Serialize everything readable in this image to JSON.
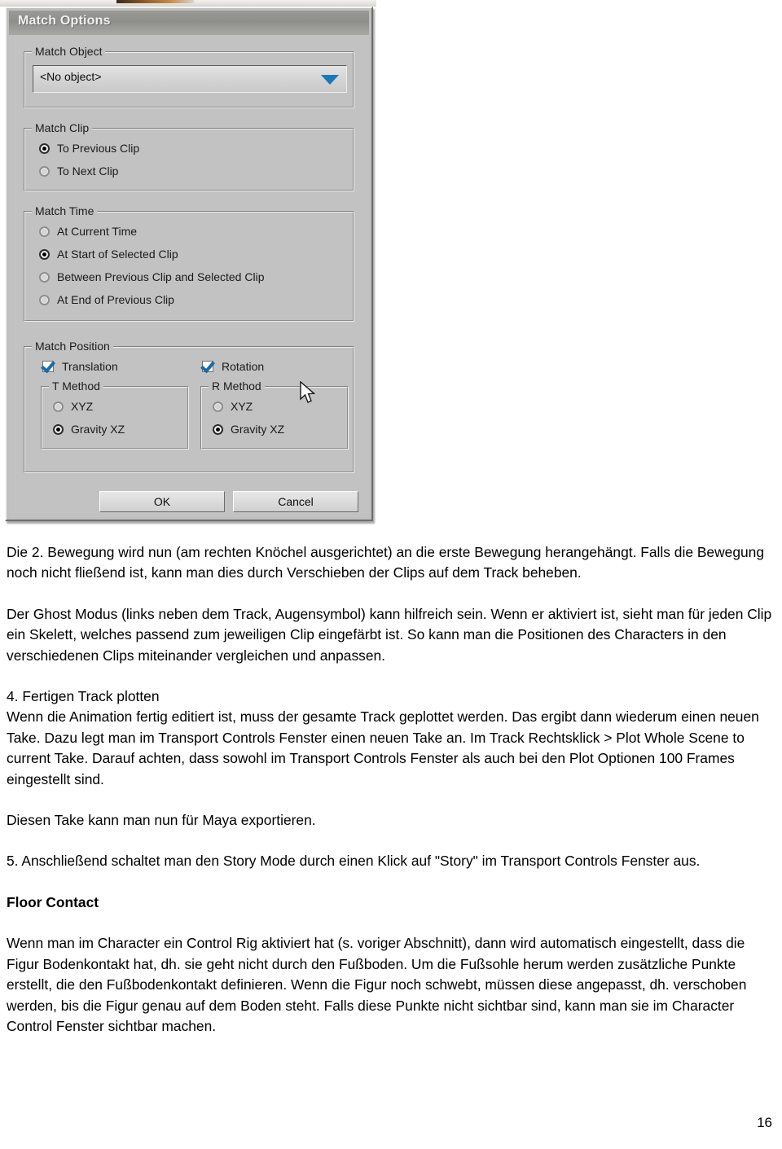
{
  "dialog": {
    "title": "Match Options",
    "match_object": {
      "group_label": "Match Object",
      "dropdown_value": "<No object>",
      "dropdown_icon": "chevron-down-icon"
    },
    "match_clip": {
      "group_label": "Match Clip",
      "options": [
        {
          "label": "To Previous Clip",
          "selected": true
        },
        {
          "label": "To Next Clip",
          "selected": false
        }
      ]
    },
    "match_time": {
      "group_label": "Match Time",
      "options": [
        {
          "label": "At Current Time",
          "selected": false
        },
        {
          "label": "At Start of Selected Clip",
          "selected": true
        },
        {
          "label": "Between Previous Clip and Selected Clip",
          "selected": false
        },
        {
          "label": "At End of Previous Clip",
          "selected": false
        }
      ]
    },
    "match_position": {
      "group_label": "Match Position",
      "translation": {
        "label": "Translation",
        "checked": true
      },
      "rotation": {
        "label": "Rotation",
        "checked": true
      },
      "t_method": {
        "group_label": "T Method",
        "options": [
          {
            "label": "XYZ",
            "selected": false
          },
          {
            "label": "Gravity XZ",
            "selected": true
          }
        ]
      },
      "r_method": {
        "group_label": "R Method",
        "options": [
          {
            "label": "XYZ",
            "selected": false
          },
          {
            "label": "Gravity XZ",
            "selected": true
          }
        ]
      }
    },
    "buttons": {
      "ok": "OK",
      "cancel": "Cancel"
    },
    "colors": {
      "face": "#c2c2c2",
      "titlebar": "#8e8e8a",
      "accent_blue": "#1b78b8",
      "check_blue": "#1c6aa8"
    }
  },
  "document": {
    "paragraph_1": "Die 2. Bewegung wird nun (am rechten Knöchel ausgerichtet) an die erste Bewegung herangehängt. Falls die Bewegung noch nicht fließend ist, kann man dies durch Verschieben der Clips auf dem Track beheben.",
    "paragraph_2": "Der Ghost Modus (links neben dem Track, Augensymbol) kann hilfreich sein. Wenn er aktiviert ist, sieht man für jeden Clip ein Skelett, welches passend zum jeweiligen Clip eingefärbt ist. So kann man die Positionen des Characters in den verschiedenen Clips miteinander vergleichen und anpassen.",
    "heading_4": "4. Fertigen Track plotten",
    "paragraph_3": "Wenn die Animation fertig editiert ist, muss der gesamte Track geplottet werden. Das ergibt dann wiederum einen neuen Take. Dazu legt man im Transport Controls Fenster einen neuen Take an. Im Track Rechtsklick > Plot Whole Scene to current Take. Darauf achten, dass sowohl im Transport Controls Fenster als auch bei den Plot Optionen 100 Frames eingestellt sind.",
    "paragraph_4": "Diesen Take kann man nun für Maya exportieren.",
    "paragraph_5": "5. Anschließend schaltet man den Story Mode durch einen Klick auf \"Story\" im Transport Controls Fenster aus.",
    "heading_floor_contact": "Floor Contact",
    "paragraph_6": "Wenn man im Character ein Control Rig aktiviert hat (s. voriger Abschnitt), dann wird automatisch eingestellt, dass die Figur Bodenkontakt hat, dh. sie geht nicht durch den Fußboden. Um die Fußsohle herum werden zusätzliche Punkte erstellt, die den Fußbodenkontakt definieren. Wenn die Figur noch schwebt, müssen diese angepasst, dh. verschoben werden, bis die Figur genau auf dem Boden steht. Falls diese Punkte nicht sichtbar sind, kann man sie im Character Control Fenster sichtbar machen.",
    "page_number": "16"
  }
}
